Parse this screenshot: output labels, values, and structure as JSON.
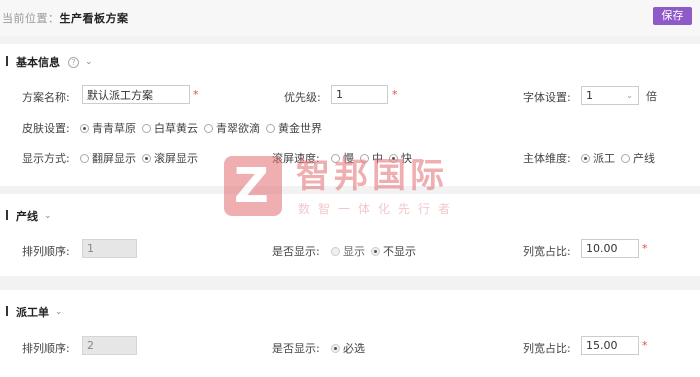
{
  "breadcrumb": {
    "prefix": "当前位置：",
    "current": "生产看板方案"
  },
  "toolbar": {
    "save_label": "保存"
  },
  "basic": {
    "title": "基本信息",
    "help_icon": "question-circle-icon",
    "scheme_name_label": "方案名称:",
    "scheme_name_value": "默认派工方案",
    "priority_label": "优先级:",
    "priority_value": "1",
    "font_label": "字体设置:",
    "font_value": "1",
    "font_unit": "倍",
    "skin_label": "皮肤设置:",
    "skin_options": [
      "青青草原",
      "白草黄云",
      "青翠欲滴",
      "黄金世界"
    ],
    "skin_selected": "青青草原",
    "display_label": "显示方式:",
    "display_options": [
      "翻屏显示",
      "滚屏显示"
    ],
    "display_selected": "滚屏显示",
    "scroll_label": "滚屏速度:",
    "scroll_options": [
      "慢",
      "中",
      "快"
    ],
    "scroll_selected": "快",
    "dimension_label": "主体维度:",
    "dimension_options": [
      "派工",
      "产线"
    ],
    "dimension_selected": "派工"
  },
  "line": {
    "title": "产线",
    "order_label": "排列顺序:",
    "order_value": "1",
    "show_label": "是否显示:",
    "show_options": [
      "显示",
      "不显示"
    ],
    "show_selected": "不显示",
    "width_label": "列宽占比:",
    "width_value": "10.00"
  },
  "dispatch": {
    "title": "派工单",
    "order_label": "排列顺序:",
    "order_value": "2",
    "show_label": "是否显示:",
    "show_option": "必选",
    "width_label": "列宽占比:",
    "width_value": "15.00"
  },
  "watermark": {
    "name": "智邦国际",
    "slogan": "数智一体化先行者",
    "logo_letter": "Z"
  },
  "colors": {
    "accent": "#8e5ac8",
    "required": "#e64a4a",
    "watermark": "#e36f73"
  }
}
